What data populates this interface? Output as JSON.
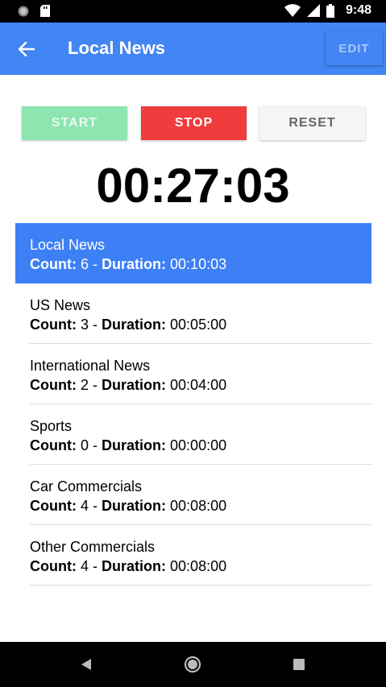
{
  "status_bar": {
    "time": "9:48"
  },
  "app_bar": {
    "title": "Local News",
    "edit_label": "EDIT"
  },
  "controls": {
    "start_label": "START",
    "stop_label": "STOP",
    "reset_label": "RESET"
  },
  "timer": {
    "value": "00:27:03"
  },
  "stats_labels": {
    "count": "Count:",
    "separator": " - ",
    "duration": "Duration:"
  },
  "topics": [
    {
      "name": "Local News",
      "count": "6",
      "duration": "00:10:03",
      "active": true
    },
    {
      "name": "US News",
      "count": "3",
      "duration": "00:05:00"
    },
    {
      "name": "International News",
      "count": "2",
      "duration": "00:04:00"
    },
    {
      "name": "Sports",
      "count": "0",
      "duration": "00:00:00"
    },
    {
      "name": "Car Commercials",
      "count": "4",
      "duration": "00:08:00"
    },
    {
      "name": "Other Commercials",
      "count": "4",
      "duration": "00:08:00"
    }
  ],
  "colors": {
    "primary": "#4285f4",
    "active_item": "#3d7ff5",
    "stop": "#f03c3c",
    "start": "#8ee5b0"
  }
}
